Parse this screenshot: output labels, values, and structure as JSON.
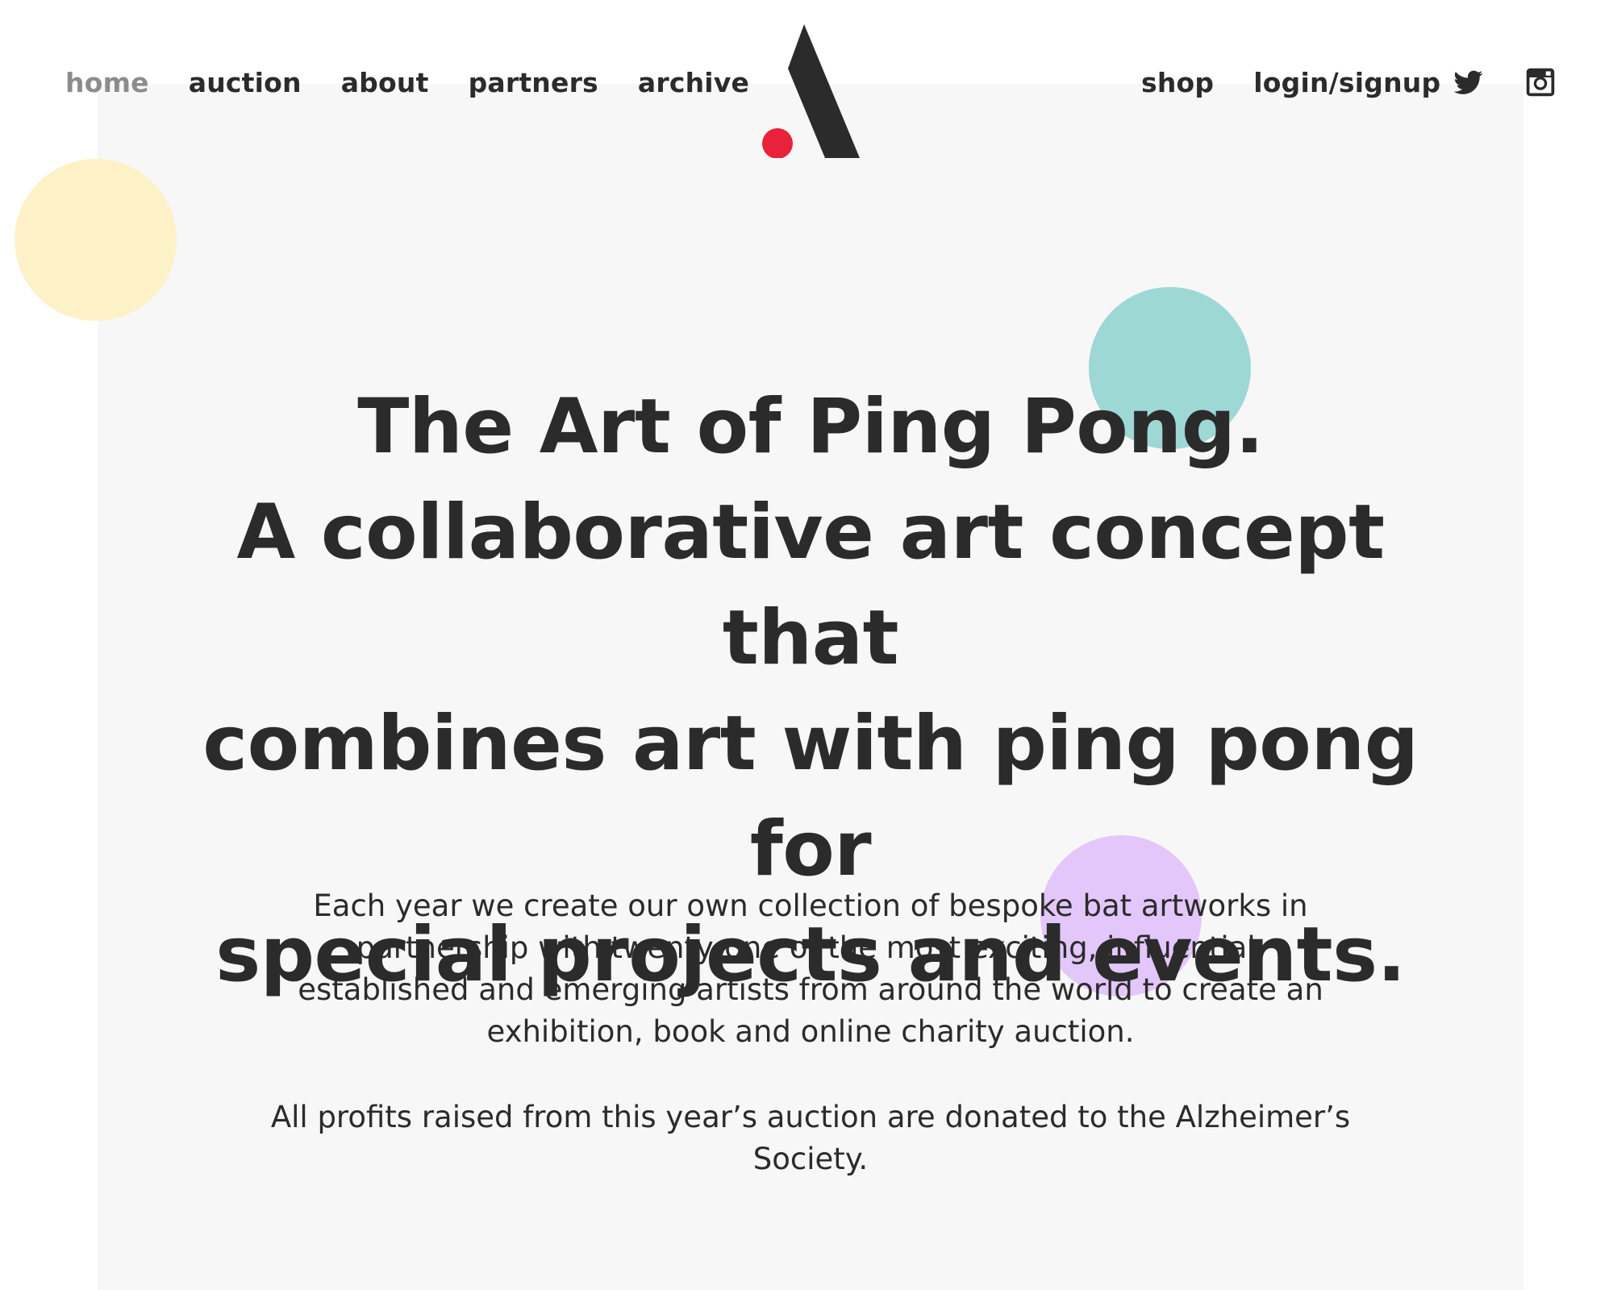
{
  "nav": {
    "left": [
      {
        "label": "home",
        "color": "#8c8c8c"
      },
      {
        "label": "auction"
      },
      {
        "label": "about"
      },
      {
        "label": "partners"
      },
      {
        "label": "archive"
      }
    ],
    "right": [
      {
        "label": "shop"
      },
      {
        "label": "login/signup"
      }
    ],
    "social_icons": [
      "twitter-icon",
      "instagram-icon"
    ]
  },
  "logo": {
    "icon": "stylized-A-logo",
    "colors": {
      "letter": "#2b2b2b",
      "dot": "#e8223a"
    }
  },
  "hero": {
    "headline_lines": [
      "The Art of Ping Pong.",
      "A collaborative art concept that",
      "combines art with ping pong for",
      "special projects and events."
    ],
    "paragraphs": [
      "Each year we create our own collection of bespoke bat artworks in partnership with twenty-one of the most exciting, influential, established and emerging artists from around the world to create an exhibition, book and online charity auction.",
      "All profits raised from this year’s auction are donated to the Alzheimer’s Society."
    ]
  },
  "decor": {
    "circle_colors": {
      "yellow": "#fdf2c7",
      "teal": "#9dd8d5",
      "purple": "#e3c6fa"
    },
    "panel_color": "#f7f7f7",
    "text_color": "#2b2b2b"
  }
}
